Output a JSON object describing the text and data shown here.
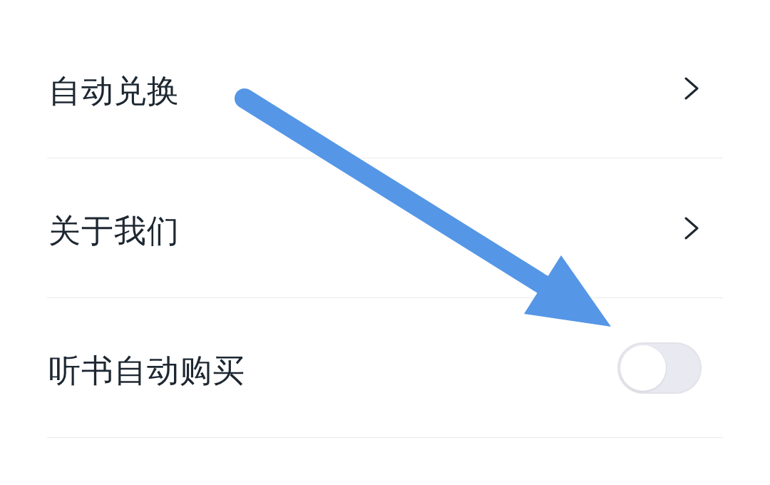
{
  "settings": [
    {
      "kind": "link",
      "label": "自动兑换"
    },
    {
      "kind": "link",
      "label": "关于我们"
    },
    {
      "kind": "toggle",
      "label": "听书自动购买",
      "on": false
    }
  ]
}
